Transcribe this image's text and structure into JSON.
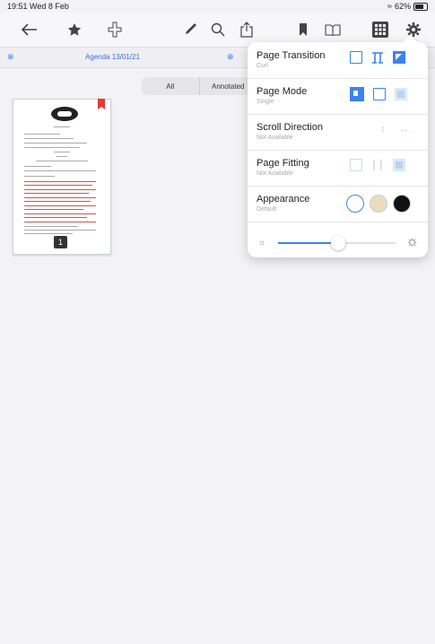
{
  "status_bar": {
    "time": "19:51  Wed 8 Feb",
    "battery": "62%",
    "battery_level": 0.62
  },
  "toolbar": {
    "icons": [
      "back-arrow-icon",
      "star-icon",
      "add-icon",
      "pen-icon",
      "search-icon",
      "share-icon",
      "bookmark-icon",
      "book-icon",
      "grid-icon",
      "settings-icon"
    ]
  },
  "tab": {
    "title": "Agenda 13/01/21"
  },
  "filter": {
    "all": "All",
    "annotated": "Annotated"
  },
  "thumbnail": {
    "page_number": "1"
  },
  "settings": {
    "page_transition": {
      "label": "Page Transition",
      "value": "Curl"
    },
    "page_mode": {
      "label": "Page Mode",
      "value": "Single"
    },
    "scroll_direction": {
      "label": "Scroll Direction",
      "value": "Not Available"
    },
    "page_fitting": {
      "label": "Page Fitting",
      "value": "Not Available"
    },
    "appearance": {
      "label": "Appearance",
      "value": "Default",
      "colors": [
        "#ffffff",
        "#e9dcc0",
        "#111111"
      ]
    },
    "brightness": {
      "level": 0.31
    }
  },
  "colors": {
    "accent": "#3b82f6"
  }
}
